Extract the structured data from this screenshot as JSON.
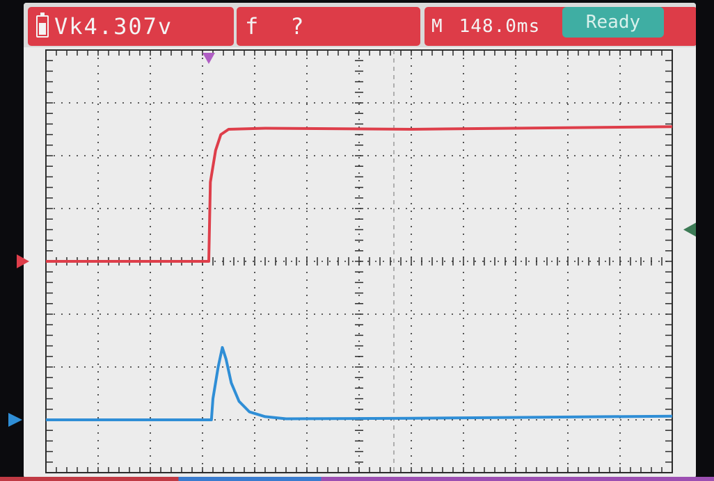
{
  "measurements": {
    "voltage": "Vk4.307v",
    "freq_label": "f",
    "freq_value": "?",
    "timebase_label": "M",
    "timebase_value": "148.0ms"
  },
  "status": "Ready",
  "colors": {
    "ch1": "#de3e4a",
    "ch2": "#2f8ed6",
    "measure_box": "#dd3c48",
    "status_box": "#3faea3",
    "grid": "#2b2b2b"
  },
  "icons": [
    "battery-icon",
    "trigger-position-marker",
    "ch1-ground-marker",
    "ch2-ground-marker",
    "trigger-level-marker"
  ],
  "chart_data": {
    "type": "line",
    "title": "",
    "xlabel": "",
    "ylabel": "",
    "grid": true,
    "xlim": [
      0,
      12
    ],
    "ylim": [
      -4,
      4
    ],
    "series": [
      {
        "channel": "CH1",
        "points": [
          [
            0,
            0
          ],
          [
            3.12,
            0
          ],
          [
            3.15,
            1.5
          ],
          [
            3.25,
            2.1
          ],
          [
            3.35,
            2.4
          ],
          [
            3.5,
            2.5
          ],
          [
            4.2,
            2.52
          ],
          [
            7,
            2.5
          ],
          [
            12,
            2.55
          ]
        ]
      },
      {
        "channel": "CH2",
        "points": [
          [
            0,
            -3.0
          ],
          [
            3.17,
            -3.0
          ],
          [
            3.2,
            -2.6
          ],
          [
            3.3,
            -2.0
          ],
          [
            3.38,
            -1.63
          ],
          [
            3.45,
            -1.85
          ],
          [
            3.55,
            -2.3
          ],
          [
            3.7,
            -2.65
          ],
          [
            3.9,
            -2.85
          ],
          [
            4.2,
            -2.94
          ],
          [
            4.6,
            -2.98
          ],
          [
            7,
            -2.97
          ],
          [
            12,
            -2.93
          ]
        ]
      }
    ]
  }
}
